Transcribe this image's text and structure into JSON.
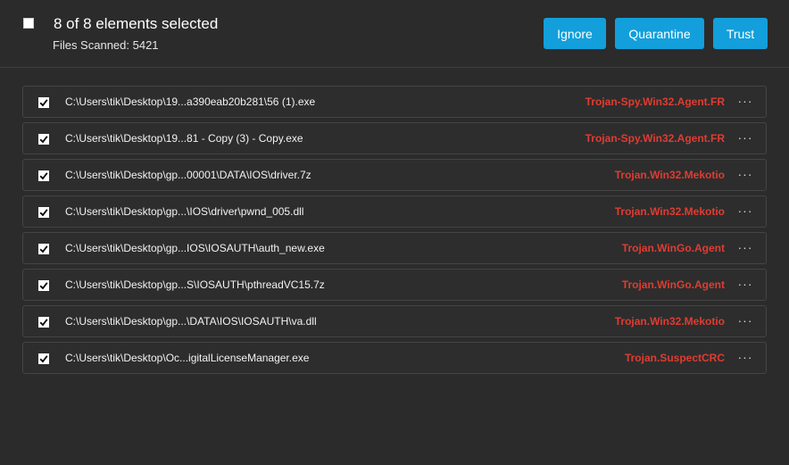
{
  "header": {
    "title": "8 of 8 elements selected",
    "subtitle": "Files Scanned: 5421",
    "master_checkbox_checked": false,
    "buttons": {
      "ignore": "Ignore",
      "quarantine": "Quarantine",
      "trust": "Trust"
    }
  },
  "colors": {
    "background": "#2b2b2b",
    "button": "#129fdb",
    "threat": "#e03c31"
  },
  "items": [
    {
      "checked": true,
      "path": "C:\\Users\\tik\\Desktop\\19...a390eab20b281\\56 (1).exe",
      "threat": "Trojan-Spy.Win32.Agent.FR",
      "more": "···"
    },
    {
      "checked": true,
      "path": "C:\\Users\\tik\\Desktop\\19...81 - Copy (3) - Copy.exe",
      "threat": "Trojan-Spy.Win32.Agent.FR",
      "more": "···"
    },
    {
      "checked": true,
      "path": "C:\\Users\\tik\\Desktop\\gp...00001\\DATA\\IOS\\driver.7z",
      "threat": "Trojan.Win32.Mekotio",
      "more": "···"
    },
    {
      "checked": true,
      "path": "C:\\Users\\tik\\Desktop\\gp...\\IOS\\driver\\pwnd_005.dll",
      "threat": "Trojan.Win32.Mekotio",
      "more": "···"
    },
    {
      "checked": true,
      "path": "C:\\Users\\tik\\Desktop\\gp...IOS\\IOSAUTH\\auth_new.exe",
      "threat": "Trojan.WinGo.Agent",
      "more": "···"
    },
    {
      "checked": true,
      "path": "C:\\Users\\tik\\Desktop\\gp...S\\IOSAUTH\\pthreadVC15.7z",
      "threat": "Trojan.WinGo.Agent",
      "more": "···"
    },
    {
      "checked": true,
      "path": "C:\\Users\\tik\\Desktop\\gp...\\DATA\\IOS\\IOSAUTH\\va.dll",
      "threat": "Trojan.Win32.Mekotio",
      "more": "···"
    },
    {
      "checked": true,
      "path": "C:\\Users\\tik\\Desktop\\Oc...igitalLicenseManager.exe",
      "threat": "Trojan.SuspectCRC",
      "more": "···"
    }
  ]
}
